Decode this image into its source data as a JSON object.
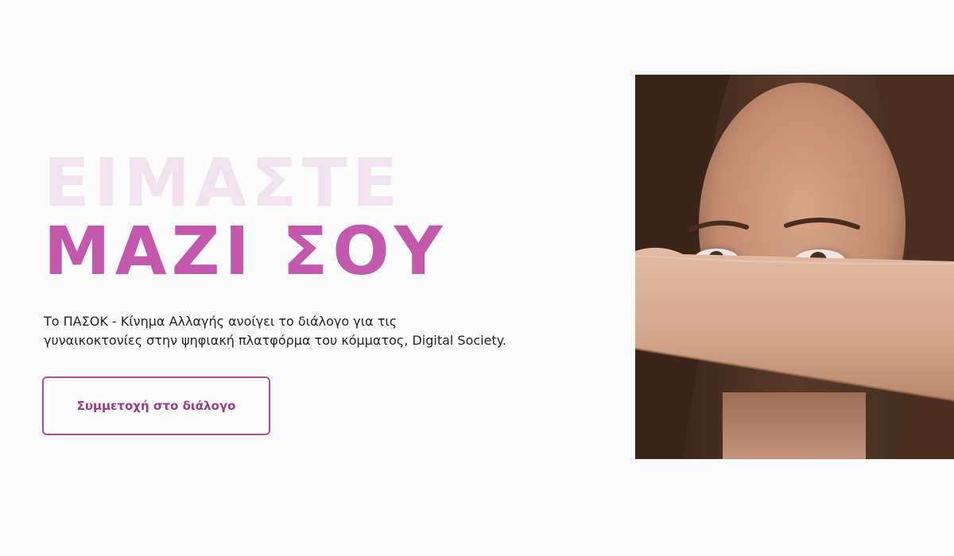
{
  "hero": {
    "headline_line1": "ΕΙΜΑΣΤΕ",
    "headline_line2": "ΜΑΖΙ ΣΟΥ",
    "description_line1": "Το ΠΑΣΟΚ - Κίνημα Αλλαγής ανοίγει το διάλογο για τις",
    "description_line2": "γυναικοκτονίες στην ψηφιακή πλατφόρμα του κόμματος, Digital Society.",
    "cta_label": "Συμμετοχή στο διάλογο"
  },
  "colors": {
    "headline_light": "#f3e2ef",
    "headline_accent": "#c358ad",
    "button_border": "#b04b97",
    "button_text": "#9c3b87",
    "body_text": "#262228",
    "background": "#fcfcfd"
  },
  "photo": {
    "icon": "woman-covering-mouth-photo"
  }
}
